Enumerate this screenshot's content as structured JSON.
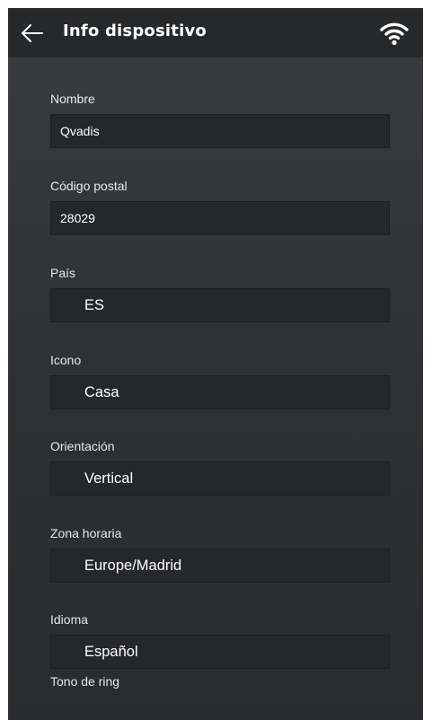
{
  "header": {
    "title": "Info dispositivo"
  },
  "fields": [
    {
      "label": "Nombre",
      "value": "Qvadis"
    },
    {
      "label": "Código postal",
      "value": "28029"
    },
    {
      "label": "País",
      "value": "ES"
    },
    {
      "label": "Icono",
      "value": "Casa"
    },
    {
      "label": "Orientación",
      "value": "Vertical"
    },
    {
      "label": "Zona horaria",
      "value": "Europe/Madrid"
    },
    {
      "label": "Idioma",
      "value": "Español"
    },
    {
      "label": "Tono de ring",
      "value": ""
    }
  ],
  "colors": {
    "header_bg": "#27282a",
    "panel_bg": "#33353a",
    "field_bg": "#26272a",
    "text": "#ffffff"
  },
  "icons": {
    "back": "arrow-left-icon",
    "status": "wifi-icon"
  }
}
